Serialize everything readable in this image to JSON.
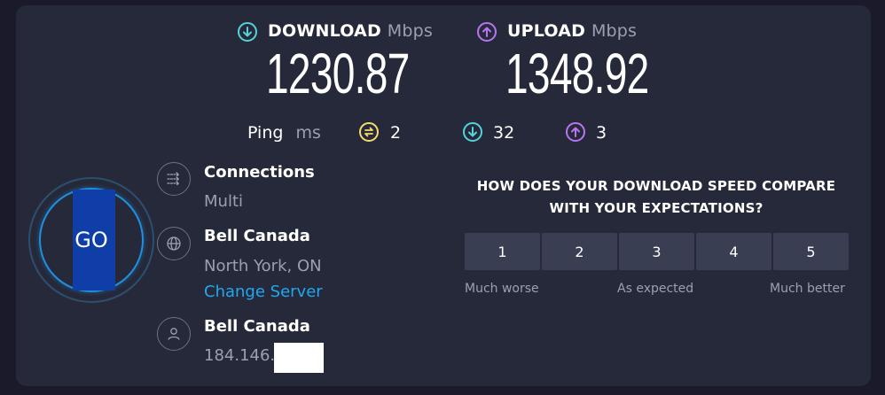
{
  "download": {
    "label": "DOWNLOAD",
    "unit": "Mbps",
    "value": "1230.87",
    "color": "#53d4d8"
  },
  "upload": {
    "label": "UPLOAD",
    "unit": "Mbps",
    "value": "1348.92",
    "color": "#b775f2"
  },
  "ping": {
    "label": "Ping",
    "unit": "ms",
    "idle": "2",
    "idle_color": "#f5dc6b",
    "down": "32",
    "down_color": "#53d4d8",
    "up": "3",
    "up_color": "#b775f2"
  },
  "go_button": {
    "label": "GO",
    "accent": "#1e90e0",
    "fill": "#0f3ea8"
  },
  "connections": {
    "title": "Connections",
    "value": "Multi",
    "icon": "connections-icon"
  },
  "server": {
    "title": "Bell Canada",
    "location": "North York, ON",
    "change_label": "Change Server",
    "icon": "globe-icon"
  },
  "provider": {
    "title": "Bell Canada",
    "ip": "184.146.1",
    "icon": "user-icon"
  },
  "survey": {
    "question_line1": "HOW DOES YOUR DOWNLOAD SPEED COMPARE",
    "question_line2": "WITH YOUR EXPECTATIONS?",
    "options": [
      "1",
      "2",
      "3",
      "4",
      "5"
    ],
    "low_label": "Much worse",
    "mid_label": "As expected",
    "high_label": "Much better"
  }
}
